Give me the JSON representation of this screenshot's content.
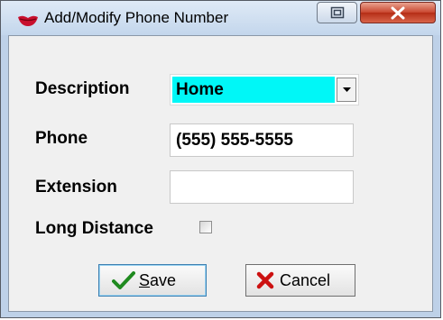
{
  "window": {
    "title": "Add/Modify Phone Number",
    "icon": "red-lips-icon"
  },
  "title_buttons": {
    "restore": "restore-icon",
    "close": "close-x-icon"
  },
  "form": {
    "description": {
      "label": "Description",
      "value": "Home"
    },
    "phone": {
      "label": "Phone",
      "value": "(555) 555-5555"
    },
    "extension": {
      "label": "Extension",
      "value": ""
    },
    "long_distance": {
      "label": "Long Distance",
      "checked": false
    }
  },
  "buttons": {
    "save": {
      "mnemonic": "S",
      "rest": "ave",
      "icon": "checkmark-icon"
    },
    "cancel": {
      "label": "Cancel",
      "icon": "red-x-icon"
    }
  },
  "colors": {
    "selected_highlight": "#00f7f7",
    "close_button": "#c8452e",
    "window_frame": "#bed1e8"
  }
}
